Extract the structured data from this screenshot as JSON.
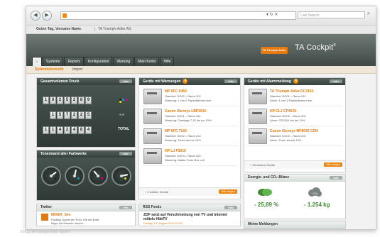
{
  "browser": {
    "back_glyph": "◀",
    "forward_glyph": "▶",
    "url_controls": "▾  ↻  ✕",
    "search_placeholder": "Live Search",
    "search_glyph": "⌕"
  },
  "greeting": {
    "user": "Guten Tag, Vorname Name",
    "company": "TA Triumph-Adler AG"
  },
  "brand": {
    "logo_text": "TA Triumph-Adler",
    "product": "TA Cockpit",
    "trademark": "®",
    "accent": "#e07b12"
  },
  "tabs": [
    "Systeme",
    "Reports",
    "Konfiguration",
    "Wartung",
    "Mein Konto",
    "Hilfe"
  ],
  "home_tab_glyph": "⌂",
  "breadcrumb": {
    "current": "Systemübersicht",
    "other": "Import"
  },
  "counter_panel": {
    "title": "Gesamtvolumen Druck",
    "button": "Info",
    "rows": [
      {
        "digits": [
          "1",
          "0",
          "2",
          "5",
          "2",
          "8",
          "9"
        ],
        "dots": [
          "#222222",
          "#00a6d6",
          "#d6007e",
          "#f2e600"
        ]
      },
      {
        "digits": [
          "1",
          "5",
          "7",
          "2",
          "2",
          "5"
        ],
        "dots": [
          "#888888",
          "#888888"
        ]
      },
      {
        "digits": [
          "1",
          "1",
          "4",
          "2",
          "4",
          "8",
          "4"
        ],
        "label": "TOTAL"
      }
    ]
  },
  "toner_panel": {
    "title": "Tonerstand aller Farbwerke",
    "button": "Info",
    "gauges": [
      {
        "color": "#222222",
        "level": 0.7
      },
      {
        "color": "#00a6d6",
        "level": 0.55
      },
      {
        "color": "#d6007e",
        "level": 0.35
      },
      {
        "color": "#f2e600",
        "level": 0.8
      }
    ]
  },
  "warnings_panel": {
    "title": "Geräte mit Warnungen",
    "count": "4",
    "button": "Info",
    "devices": [
      {
        "name": "MP 6FC 6460",
        "location": "Standort: DG02 – Raum 202",
        "status": "Warnung: 1 von 2 Papierfächern leer"
      },
      {
        "name": "Canon iSensys LBP3010",
        "location": "Standort: DG01 – Raum 011",
        "status": "Warnung: Cartridge 7,15 bis zur 10%"
      },
      {
        "name": "MP 6FC 7150",
        "location": "Standort: DG02 – Raum 202",
        "status": "Warnung: Toner wie bei 10%"
      },
      {
        "name": "HP LJ P3015",
        "location": "Standort: DG04 – Raum 402",
        "status": "Warnung: Waste Toner Box voll"
      }
    ],
    "footer_text": "+ 2 weitere Geräte",
    "footer_button": "Alle zeigen"
  },
  "alarms_panel": {
    "title": "Geräte mit Alarmmeldung",
    "count": "4",
    "button": "Info",
    "devices": [
      {
        "name": "TA Triumph-Adler DC2162",
        "location": "Standort: DG01 – Raum 011",
        "status": "Alarm: 1 von 2 Papierfächern leer"
      },
      {
        "name": "HP CLJ CP4525",
        "location": "Standort: DG02 – Raum 202",
        "status": "Alarm: CE250X bis bei 10%"
      },
      {
        "name": "Canon iSensys MF8030 CDN",
        "location": "Standort: DG02 – Raum 202",
        "status": "Alarm: Toner bis bei 10%"
      }
    ],
    "footer_text": "+ 25 weitere Geräte",
    "footer_button": "Alle zeigen"
  },
  "energy_panel": {
    "title": "Energie- und CO₂-Bilanz",
    "button": "Info",
    "percent_value": "- 25,89 %",
    "co2_value": "- 1.254 kg",
    "co2_label": "CO₂",
    "green": "#3c8c2e"
  },
  "twitter_panel": {
    "title": "Twitter",
    "button": "Info",
    "name": "MIXER_See",
    "lines": [
      "Fantasy-Spiele per Post. Hie der Brett",
      "bilger die Mainser brache ..."
    ]
  },
  "rss_panel": {
    "title": "RSS Feeds",
    "button": "Info",
    "headline": "ZDF setzt auf Verschmelzung von TV und Internet mittels HbbTV",
    "date": "Freitag, 13. August 2010 10:00"
  },
  "news_panel": {
    "title": "Meine Meldungen"
  },
  "copyright": "©2011 TA Triumph-Adler GmbH"
}
